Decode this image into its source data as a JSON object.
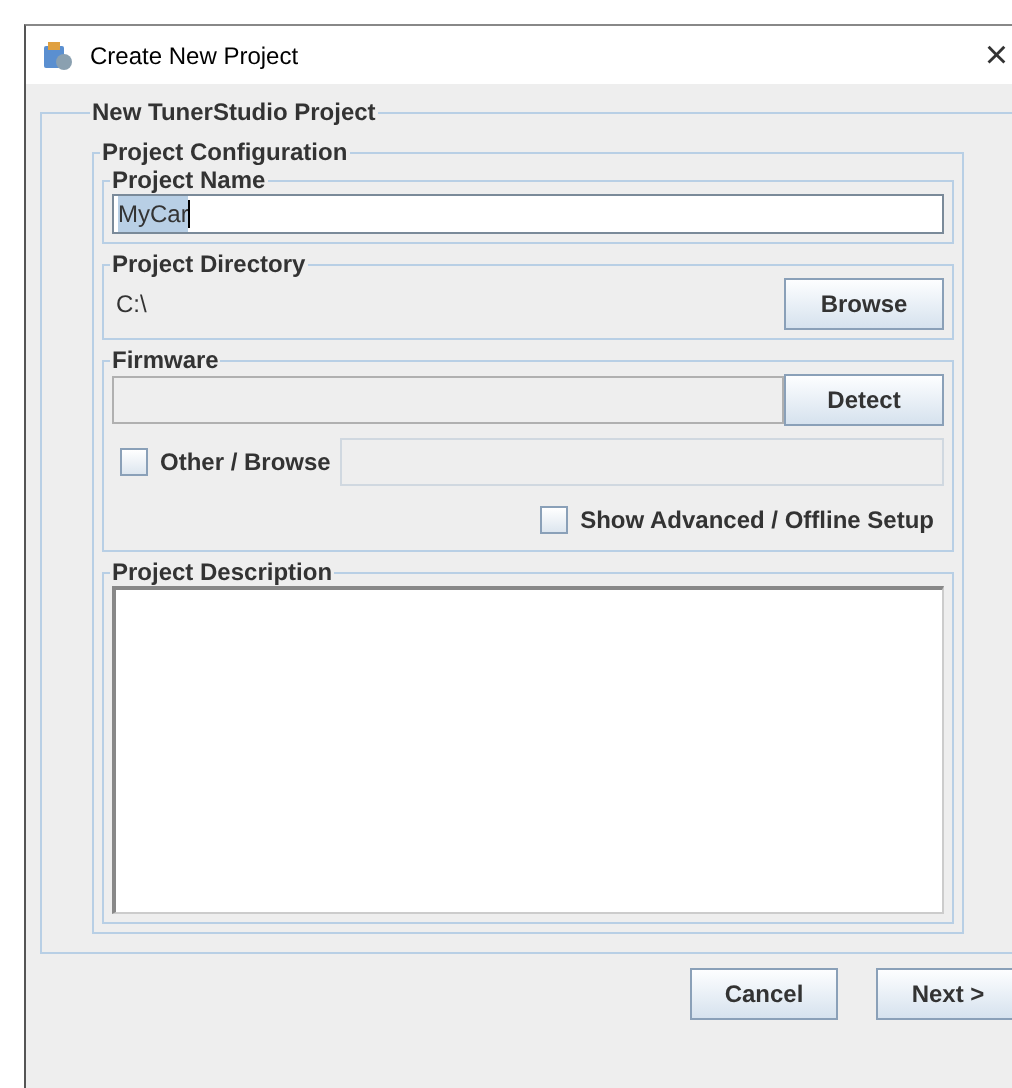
{
  "window": {
    "title": "Create New Project",
    "close": "×"
  },
  "project": {
    "legend": "New TunerStudio Project",
    "configuration": {
      "legend": "Project Configuration",
      "name": {
        "legend": "Project Name",
        "value": "MyCar",
        "text_selected": true
      },
      "directory": {
        "legend": "Project Directory",
        "value": "C:\\",
        "button": "Browse"
      },
      "firmware": {
        "legend": "Firmware",
        "button": "Detect",
        "other": {
          "label": "Other / Browse",
          "checked": false
        },
        "advanced": {
          "label": "Show Advanced / Offline Setup",
          "checked": false
        }
      },
      "description": {
        "legend": "Project Description"
      }
    }
  },
  "buttons": [
    {
      "label": "Cancel"
    },
    {
      "label": "Next >"
    }
  ]
}
